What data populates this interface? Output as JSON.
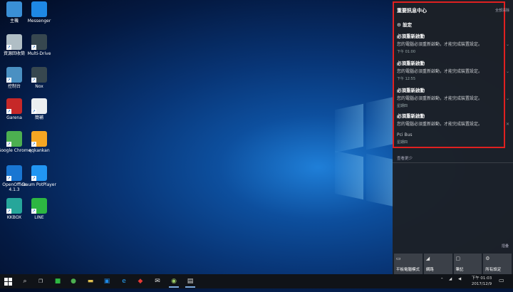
{
  "desktop": {
    "icons": [
      {
        "label": "主機",
        "color": "#3a8fd6"
      },
      {
        "label": "Messenger",
        "color": "#1e88e5"
      },
      {
        "label": "資源回收筒",
        "color": "#b0bec5"
      },
      {
        "label": "Multi-Drive",
        "color": "#37474f"
      },
      {
        "label": "控制台",
        "color": "#4a90c2"
      },
      {
        "label": "Nox",
        "color": "#37474f"
      },
      {
        "label": "Garena",
        "color": "#c62828"
      },
      {
        "label": "簡補",
        "color": "#eceff1"
      },
      {
        "label": "Google Chrome",
        "color": "#4caf50"
      },
      {
        "label": "qqkankan",
        "color": "#f5a623"
      },
      {
        "label": "OpenOffice 4.1.3",
        "color": "#1976d2"
      },
      {
        "label": "Daum PotPlayer",
        "color": "#2196f3"
      },
      {
        "label": "KKBOX",
        "color": "#26a69a"
      },
      {
        "label": "LINE",
        "color": "#2db742"
      }
    ]
  },
  "action_center": {
    "title": "重要訊息中心",
    "clear_all": "全部清除",
    "settings_label": "設定",
    "notifications": [
      {
        "title": "必須重新啟動",
        "body": "您的電腦必須重新啟動，才能完成裝置設定。",
        "time": "下午 01:00"
      },
      {
        "title": "必須重新啟動",
        "body": "您的電腦必須重新啟動，才能完成裝置設定。",
        "time": "下午 12:55"
      },
      {
        "title": "必須重新啟動",
        "body": "您的電腦必須重新啟動，才能完成裝置設定。",
        "time": "星期四"
      },
      {
        "title": "必須重新啟動",
        "body": "您的電腦必須重新啟動，才能完成裝置設定。",
        "source": "Pci Bus",
        "time": "星期四"
      }
    ],
    "see_less": "查看更少",
    "collapse": "摺疊",
    "quick_actions": [
      {
        "label": "平板電腦模式",
        "icon": "tablet-icon"
      },
      {
        "label": "網路",
        "icon": "network-icon"
      },
      {
        "label": "筆記",
        "icon": "note-icon"
      },
      {
        "label": "所有設定",
        "icon": "settings-icon"
      }
    ],
    "highlight_color": "#e02020"
  },
  "taskbar": {
    "time": "下午 01:03",
    "date": "2017/12/9"
  }
}
